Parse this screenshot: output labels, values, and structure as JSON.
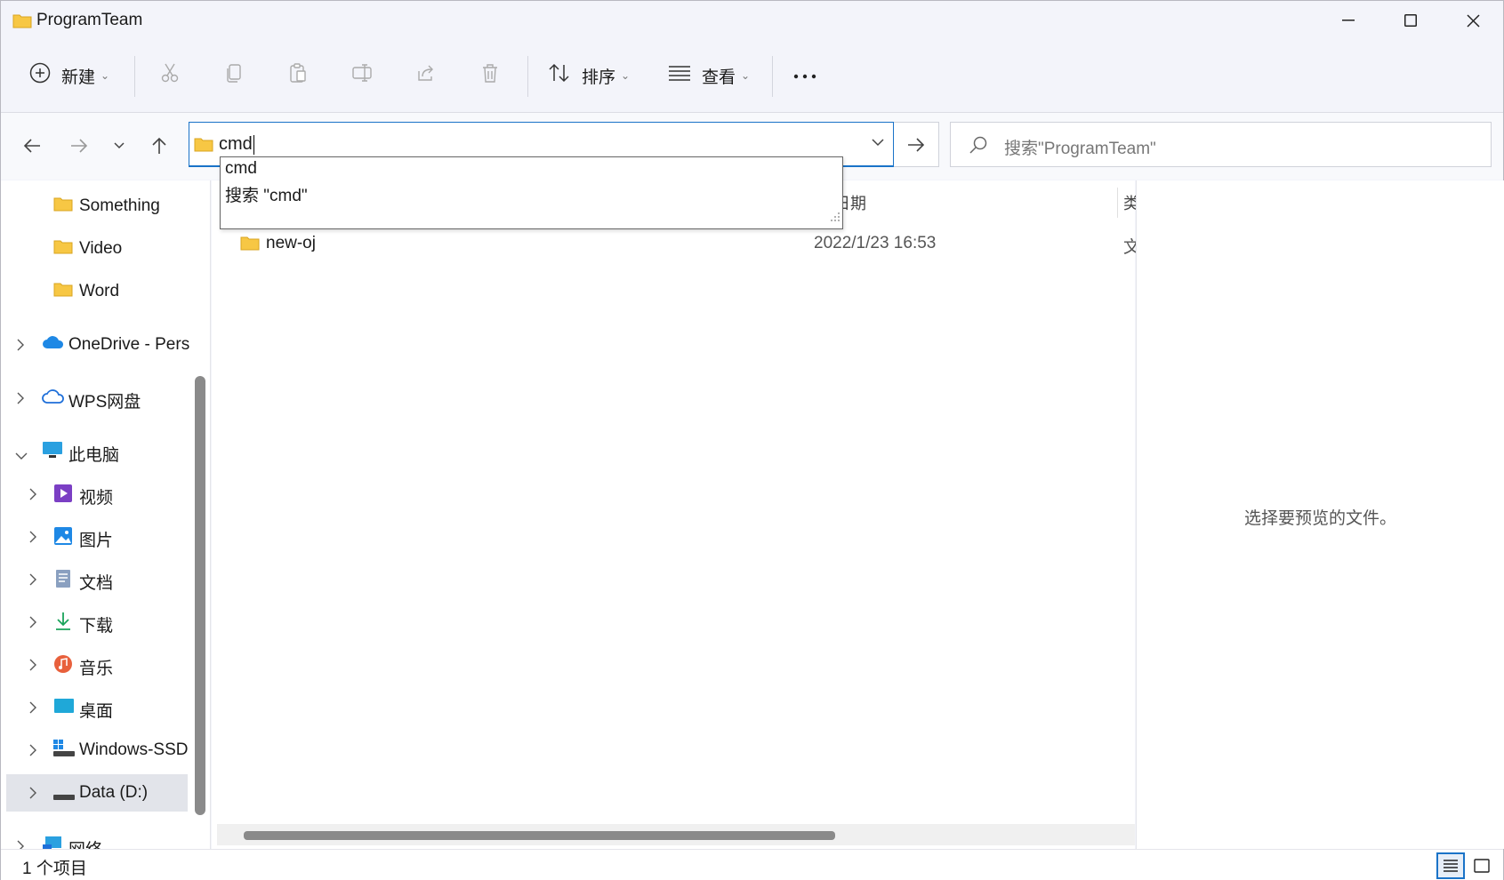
{
  "window": {
    "title": "ProgramTeam"
  },
  "toolbar": {
    "new_label": "新建",
    "sort_label": "排序",
    "view_label": "查看"
  },
  "address": {
    "value": "cmd"
  },
  "search": {
    "placeholder": "搜索\"ProgramTeam\""
  },
  "autocomplete": {
    "items": [
      "cmd",
      "搜索 \"cmd\""
    ]
  },
  "sidebar": {
    "items": [
      {
        "label": "Something",
        "icon": "folder-icon"
      },
      {
        "label": "Video",
        "icon": "folder-icon"
      },
      {
        "label": "Word",
        "icon": "folder-icon"
      },
      {
        "label": "OneDrive - Pers",
        "icon": "onedrive-icon"
      },
      {
        "label": "WPS网盘",
        "icon": "cloud-icon"
      },
      {
        "label": "此电脑",
        "icon": "pc-icon"
      },
      {
        "label": "视频",
        "icon": "video-icon"
      },
      {
        "label": "图片",
        "icon": "picture-icon"
      },
      {
        "label": "文档",
        "icon": "document-icon"
      },
      {
        "label": "下载",
        "icon": "download-icon"
      },
      {
        "label": "音乐",
        "icon": "music-icon"
      },
      {
        "label": "桌面",
        "icon": "desktop-icon"
      },
      {
        "label": "Windows-SSD",
        "icon": "drive-icon"
      },
      {
        "label": "Data (D:)",
        "icon": "drive-icon"
      },
      {
        "label": "网络",
        "icon": "network-icon"
      }
    ]
  },
  "content": {
    "columns": [
      "日期",
      "类"
    ],
    "rows": [
      {
        "name": "new-oj",
        "date": "2022/1/23 16:53",
        "type": "文"
      }
    ]
  },
  "preview": {
    "message": "选择要预览的文件。"
  },
  "status": {
    "count": "1 个项目"
  },
  "colors": {
    "accent": "#1a73c8",
    "folder": "#f7c744"
  }
}
